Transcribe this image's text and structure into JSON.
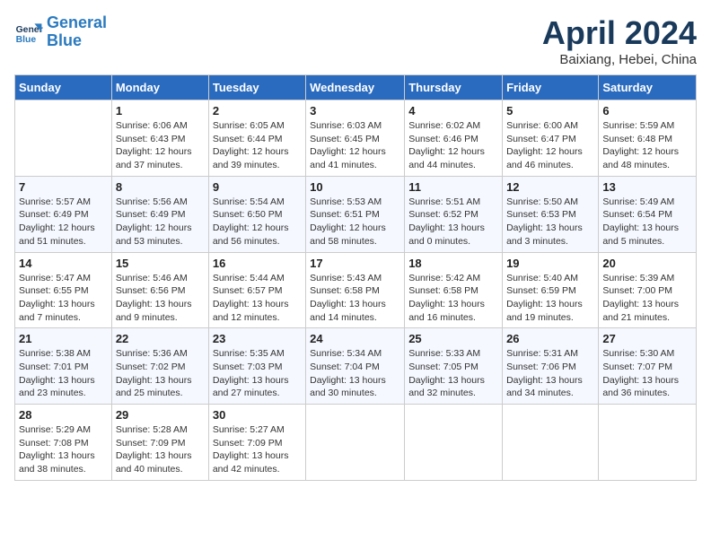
{
  "logo": {
    "line1": "General",
    "line2": "Blue"
  },
  "title": "April 2024",
  "subtitle": "Baixiang, Hebei, China",
  "weekdays": [
    "Sunday",
    "Monday",
    "Tuesday",
    "Wednesday",
    "Thursday",
    "Friday",
    "Saturday"
  ],
  "weeks": [
    [
      {
        "day": "",
        "info": ""
      },
      {
        "day": "1",
        "info": "Sunrise: 6:06 AM\nSunset: 6:43 PM\nDaylight: 12 hours\nand 37 minutes."
      },
      {
        "day": "2",
        "info": "Sunrise: 6:05 AM\nSunset: 6:44 PM\nDaylight: 12 hours\nand 39 minutes."
      },
      {
        "day": "3",
        "info": "Sunrise: 6:03 AM\nSunset: 6:45 PM\nDaylight: 12 hours\nand 41 minutes."
      },
      {
        "day": "4",
        "info": "Sunrise: 6:02 AM\nSunset: 6:46 PM\nDaylight: 12 hours\nand 44 minutes."
      },
      {
        "day": "5",
        "info": "Sunrise: 6:00 AM\nSunset: 6:47 PM\nDaylight: 12 hours\nand 46 minutes."
      },
      {
        "day": "6",
        "info": "Sunrise: 5:59 AM\nSunset: 6:48 PM\nDaylight: 12 hours\nand 48 minutes."
      }
    ],
    [
      {
        "day": "7",
        "info": "Sunrise: 5:57 AM\nSunset: 6:49 PM\nDaylight: 12 hours\nand 51 minutes."
      },
      {
        "day": "8",
        "info": "Sunrise: 5:56 AM\nSunset: 6:49 PM\nDaylight: 12 hours\nand 53 minutes."
      },
      {
        "day": "9",
        "info": "Sunrise: 5:54 AM\nSunset: 6:50 PM\nDaylight: 12 hours\nand 56 minutes."
      },
      {
        "day": "10",
        "info": "Sunrise: 5:53 AM\nSunset: 6:51 PM\nDaylight: 12 hours\nand 58 minutes."
      },
      {
        "day": "11",
        "info": "Sunrise: 5:51 AM\nSunset: 6:52 PM\nDaylight: 13 hours\nand 0 minutes."
      },
      {
        "day": "12",
        "info": "Sunrise: 5:50 AM\nSunset: 6:53 PM\nDaylight: 13 hours\nand 3 minutes."
      },
      {
        "day": "13",
        "info": "Sunrise: 5:49 AM\nSunset: 6:54 PM\nDaylight: 13 hours\nand 5 minutes."
      }
    ],
    [
      {
        "day": "14",
        "info": "Sunrise: 5:47 AM\nSunset: 6:55 PM\nDaylight: 13 hours\nand 7 minutes."
      },
      {
        "day": "15",
        "info": "Sunrise: 5:46 AM\nSunset: 6:56 PM\nDaylight: 13 hours\nand 9 minutes."
      },
      {
        "day": "16",
        "info": "Sunrise: 5:44 AM\nSunset: 6:57 PM\nDaylight: 13 hours\nand 12 minutes."
      },
      {
        "day": "17",
        "info": "Sunrise: 5:43 AM\nSunset: 6:58 PM\nDaylight: 13 hours\nand 14 minutes."
      },
      {
        "day": "18",
        "info": "Sunrise: 5:42 AM\nSunset: 6:58 PM\nDaylight: 13 hours\nand 16 minutes."
      },
      {
        "day": "19",
        "info": "Sunrise: 5:40 AM\nSunset: 6:59 PM\nDaylight: 13 hours\nand 19 minutes."
      },
      {
        "day": "20",
        "info": "Sunrise: 5:39 AM\nSunset: 7:00 PM\nDaylight: 13 hours\nand 21 minutes."
      }
    ],
    [
      {
        "day": "21",
        "info": "Sunrise: 5:38 AM\nSunset: 7:01 PM\nDaylight: 13 hours\nand 23 minutes."
      },
      {
        "day": "22",
        "info": "Sunrise: 5:36 AM\nSunset: 7:02 PM\nDaylight: 13 hours\nand 25 minutes."
      },
      {
        "day": "23",
        "info": "Sunrise: 5:35 AM\nSunset: 7:03 PM\nDaylight: 13 hours\nand 27 minutes."
      },
      {
        "day": "24",
        "info": "Sunrise: 5:34 AM\nSunset: 7:04 PM\nDaylight: 13 hours\nand 30 minutes."
      },
      {
        "day": "25",
        "info": "Sunrise: 5:33 AM\nSunset: 7:05 PM\nDaylight: 13 hours\nand 32 minutes."
      },
      {
        "day": "26",
        "info": "Sunrise: 5:31 AM\nSunset: 7:06 PM\nDaylight: 13 hours\nand 34 minutes."
      },
      {
        "day": "27",
        "info": "Sunrise: 5:30 AM\nSunset: 7:07 PM\nDaylight: 13 hours\nand 36 minutes."
      }
    ],
    [
      {
        "day": "28",
        "info": "Sunrise: 5:29 AM\nSunset: 7:08 PM\nDaylight: 13 hours\nand 38 minutes."
      },
      {
        "day": "29",
        "info": "Sunrise: 5:28 AM\nSunset: 7:09 PM\nDaylight: 13 hours\nand 40 minutes."
      },
      {
        "day": "30",
        "info": "Sunrise: 5:27 AM\nSunset: 7:09 PM\nDaylight: 13 hours\nand 42 minutes."
      },
      {
        "day": "",
        "info": ""
      },
      {
        "day": "",
        "info": ""
      },
      {
        "day": "",
        "info": ""
      },
      {
        "day": "",
        "info": ""
      }
    ]
  ]
}
